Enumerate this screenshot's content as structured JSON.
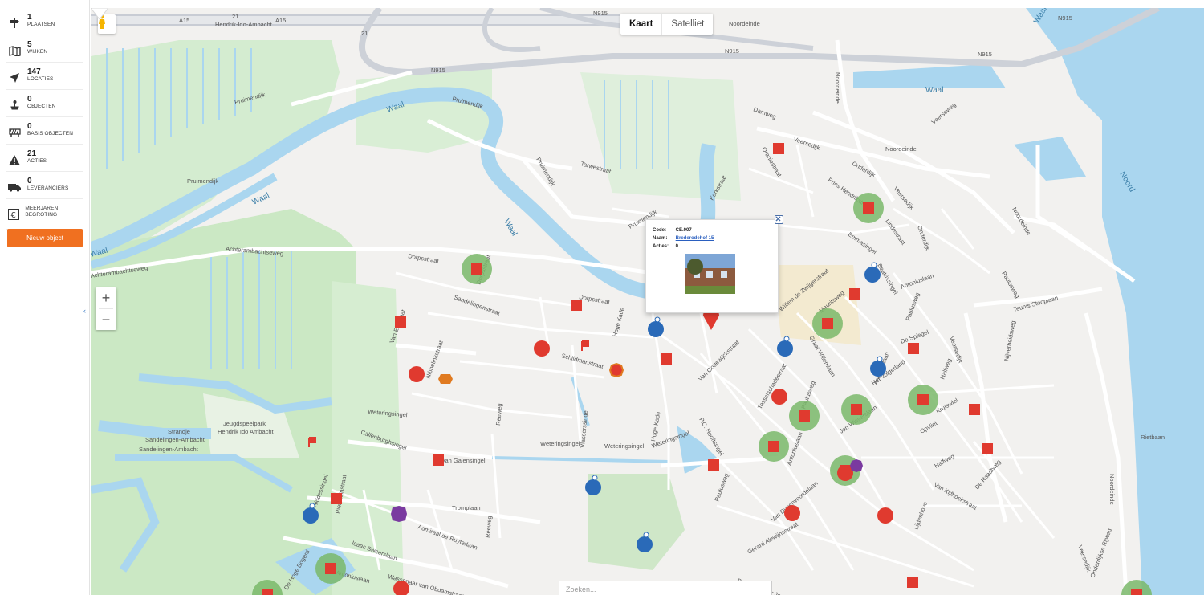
{
  "sidebar": {
    "stats": [
      {
        "count": "1",
        "label": "PLAATSEN",
        "icon": "signpost-icon"
      },
      {
        "count": "5",
        "label": "WIJKEN",
        "icon": "map-icon"
      },
      {
        "count": "147",
        "label": "LOCATIES",
        "icon": "navigation-arrow-icon"
      },
      {
        "count": "0",
        "label": "OBJECTEN",
        "icon": "playground-object-icon"
      },
      {
        "count": "0",
        "label": "BASIS OBJECTEN",
        "icon": "barrier-icon"
      },
      {
        "count": "21",
        "label": "ACTIES",
        "icon": "warning-icon"
      },
      {
        "count": "0",
        "label": "LEVERANCIERS",
        "icon": "truck-icon"
      },
      {
        "count": "",
        "label": "MEERJAREN BEGROTING",
        "icon": "euro-icon"
      }
    ],
    "new_object_label": "Nieuw object",
    "collapse_glyph": "‹"
  },
  "map": {
    "map_type": {
      "map_label": "Kaart",
      "satellite_label": "Satelliet"
    },
    "zoom_in": "+",
    "zoom_out": "−",
    "search_placeholder": "Zoeken...",
    "road_labels": {
      "a15_1": "A15",
      "a15_2": "A15",
      "hia": "Hendrik-Ido-Ambacht",
      "exit21": "21",
      "exit21b": "21",
      "n915_1": "N915",
      "n915_2": "N915",
      "n915_3": "N915",
      "n915_4": "N915",
      "n915_5": "N915",
      "noordeinde1": "Noordeinde",
      "noordeinde2": "Noordeinde",
      "noordeinde3": "Noordeinde",
      "noordeinde4": "Noordeinde",
      "noordeinde5": "Noordeinde",
      "pruimendijk1": "Pruimendijk",
      "pruimendijk2": "Pruimendijk",
      "pruimendijk3": "Pruimendijk",
      "pruimendijk4": "Pruimendijk",
      "pruimendijk5": "Pruimendijk",
      "tarwestraat": "Tarwestraat",
      "damweg": "Damweg",
      "veersedijk1": "Veersedijk",
      "veersedijk2": "Veersedijk",
      "veersedijk3": "Veersedijk",
      "veersedijk4": "Veersedijk",
      "oranjestraat": "Oranjestraat",
      "kerkstraat": "Kerkstraat",
      "onderdijk1": "Onderdijk",
      "onderdijk2": "Onderdijk",
      "prinshendrik": "Prins Hendrikstraat",
      "lindestraat": "Lindestraat",
      "emmasingel": "Emmasingel",
      "achterambachtseweg1": "Achterambachtseweg",
      "achterambachtseweg2": "Achterambachtseweg",
      "dorpsstraat1": "Dorpsstraat",
      "dorpsstraat2": "Dorpsstraat",
      "dorpsstraat3": "Dorpsstraat",
      "sandelingenstraat": "Sandelingenstraat",
      "vaneikstraat": "Van Eikstraat",
      "nibbelinkstraat": "Nibbelinkstraat",
      "schildmanstraat": "Schildmanstraat",
      "hogekade1": "Hoge Kade",
      "hogekade2": "Hoge Kade",
      "weteringsingel1": "Weteringsingel",
      "weteringsingel2": "Weteringsingel",
      "weteringsingel3": "Weteringsingel",
      "weteringsingel4": "Weteringsingel",
      "reeweg1": "Reeweg",
      "reeweg2": "Reeweg",
      "vlasserssingel": "Vlasserssingel",
      "callenburghsingel": "Callenburghsingel",
      "vangalensingel": "Van Galensingel",
      "tromplaan": "Tromplaan",
      "admiraal": "Admiraal de Ruyterlaan",
      "isaac": "Isaac Sweerslaan",
      "wassenaar": "Wassenaar van Obdamstraat",
      "antoniuslaan1": "Antoniuslaan",
      "antoniuslaan2": "Antoniuslaan",
      "antoniuslaan3": "Antoniuslaan",
      "tjerk": "Tjerk Hiddessingel",
      "piet": "Piet Heinstraat",
      "dehogebogerd": "De Hoge Bogerd",
      "vangodewijck": "Van Godewijckstraat",
      "pchooft": "P.C. Hooftsingel",
      "tesselschade": "Tesselschadestraat",
      "graafwillem": "Graaf Willemlaan",
      "janwissen": "Jan Wisserslaan",
      "paulusweg1": "Paulusweg",
      "paulusweg2": "Paulusweg",
      "paulusweg3": "Paulusweg",
      "vanduvenvoorde": "Van Duvenvoordelaan",
      "gerard": "Gerard Alewijnsstraat",
      "burgemeester": "Burgemeester Jonkerstraat",
      "lijdenhove": "Lijdenhove",
      "vankijfhoek": "Van Kijfhoekstraat",
      "derasdtweg": "De Raadtweg",
      "halfweg1": "Halfweg",
      "halfweg2": "Halfweg",
      "opvliet": "Opvliet",
      "kruiswiel": "Kruiswiel",
      "hetvolgerland": "Het Volgerland",
      "despiegel": "De Spiegel",
      "teunis": "Teunis Stooplaan",
      "nijverheidsweg": "Nijverheidsweg",
      "veerseweg": "Veerseweg",
      "rietbaan": "Rietbaan",
      "onderdijkserijweg": "Onderdijkse Rijweg",
      "willem": "Willem de Zwijgerstraat",
      "mauritsweg": "Mauritsweg",
      "beatrixsingel": "Beatrixsingel",
      "antoniuslaan4": "Antoniuslaan",
      "paulusweg4": "Paulusweg",
      "sandelingen": "Sandelingen-Ambacht",
      "jeugdspeelpark": "Jeugdspeelpark",
      "hendrik": "Hendrik Ido Ambacht",
      "strandje": "Strandje",
      "sandelingen2": "Sandelingen-Ambacht"
    },
    "water_labels": {
      "waal1": "Waal",
      "waal2": "Waal",
      "waal3": "Waal",
      "waal4": "Waal",
      "waal5": "Waal",
      "waal6": "Waal",
      "noord": "Noord"
    },
    "popup": {
      "code_key": "Code:",
      "code_value": "CE.007",
      "name_key": "Naam:",
      "name_value": "Brederodehof 15",
      "actions_key": "Acties:",
      "actions_value": "0"
    }
  },
  "colors": {
    "accent": "#f07020",
    "marker_red": "#e03a2f",
    "marker_blue": "#2a6ab8",
    "marker_green": "#7ab86a",
    "marker_purple": "#7a3aa0",
    "marker_orange": "#e07a20",
    "water": "#aadaff",
    "park": "#c8e6c0"
  }
}
